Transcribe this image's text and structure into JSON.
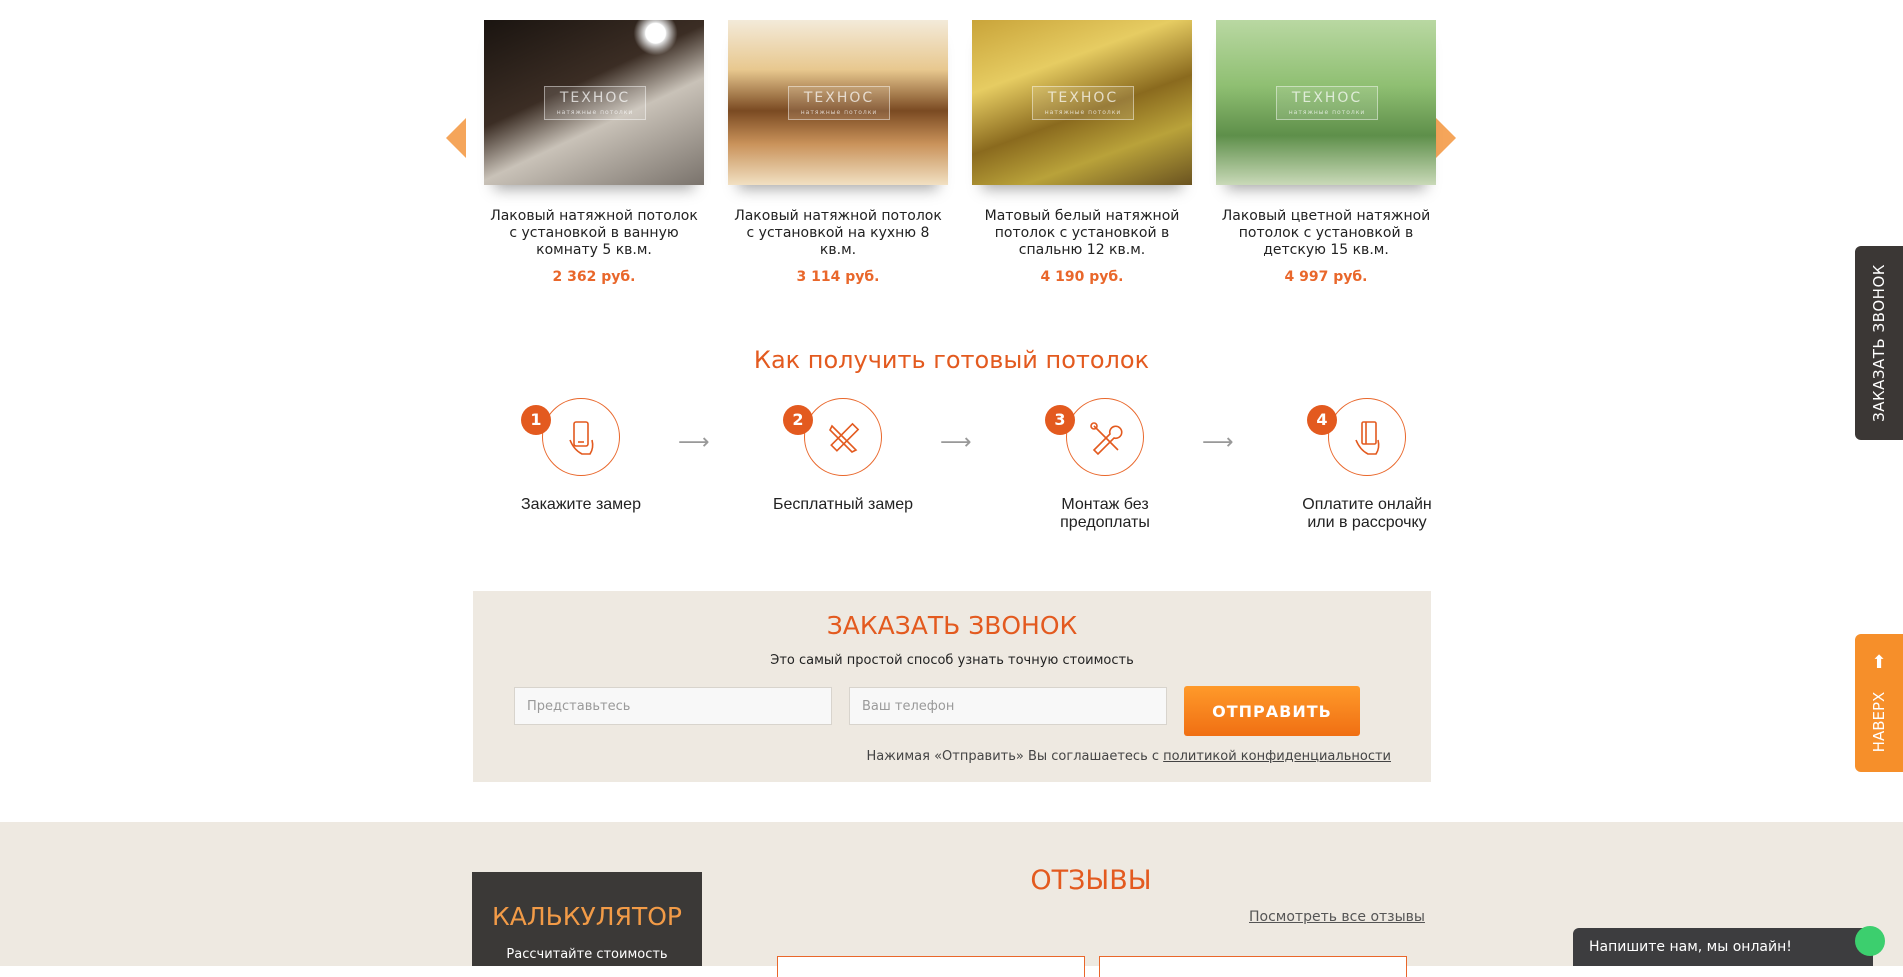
{
  "carousel": {
    "items": [
      {
        "title": "Лаковый натяжной потолок с установкой в ванную комнату 5 кв.м.",
        "price": "2 362 руб.",
        "watermark": "ТЕХНОС",
        "watermark_sub": "натяжные потолки"
      },
      {
        "title": "Лаковый натяжной потолок с установкой на кухню 8 кв.м.",
        "price": "3 114 руб.",
        "watermark": "ТЕХНОС",
        "watermark_sub": "натяжные потолки"
      },
      {
        "title": "Матовый белый натяжной потолок с установкой в спальню 12 кв.м.",
        "price": "4 190 руб.",
        "watermark": "ТЕХНОС",
        "watermark_sub": "натяжные потолки"
      },
      {
        "title": "Лаковый цветной натяжной потолок с установкой в детскую 15 кв.м.",
        "price": "4 997 руб.",
        "watermark": "ТЕХНОС",
        "watermark_sub": "натяжные потолки"
      }
    ]
  },
  "steps": {
    "title": "Как получить готовый потолок",
    "items": [
      {
        "num": "1",
        "label": "Закажите замер",
        "icon": "phone-hand-icon"
      },
      {
        "num": "2",
        "label": "Бесплатный замер",
        "icon": "pencil-ruler-icon"
      },
      {
        "num": "3",
        "label": "Монтаж без предоплаты",
        "icon": "tools-icon"
      },
      {
        "num": "4",
        "label": "Оплатите онлайн или в рассрочку",
        "icon": "card-hand-icon"
      }
    ]
  },
  "callback": {
    "title": "ЗАКАЗАТЬ ЗВОНОК",
    "subtitle": "Это самый простой способ узнать точную стоимость",
    "name_placeholder": "Представьтесь",
    "phone_placeholder": "Ваш телефон",
    "submit_label": "ОТПРАВИТЬ",
    "consent_text": "Нажимая «Отправить» Вы соглашаетесь с",
    "consent_link": "политикой конфиденциальности"
  },
  "calculator": {
    "title": "КАЛЬКУЛЯТОР",
    "subtitle": "Рассчитайте стоимость"
  },
  "reviews": {
    "title": "ОТЗЫВЫ",
    "all_link": "Посмотреть все отзывы"
  },
  "side_tabs": {
    "call_label": "ЗАКАЗАТЬ ЗВОНОК",
    "top_label": "НАВЕРХ"
  },
  "chat": {
    "label": "Напишите нам, мы онлайн!"
  },
  "colors": {
    "accent": "#e35a1f",
    "button": "#f27a1a",
    "panel_bg": "#eee9e1",
    "dark_tab": "#3b3735"
  }
}
